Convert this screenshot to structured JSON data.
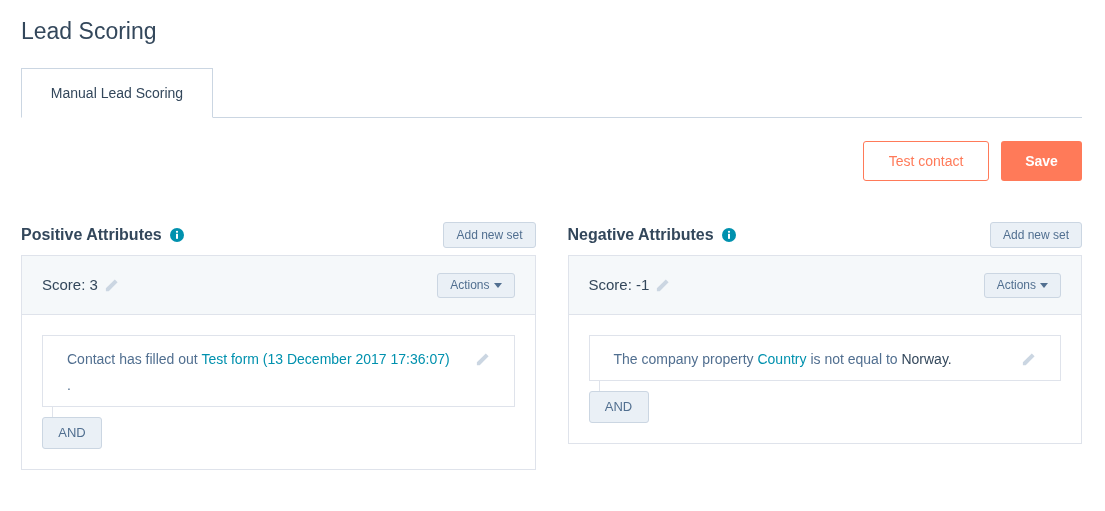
{
  "page_title": "Lead Scoring",
  "tabs": [
    {
      "label": "Manual Lead Scoring",
      "selected": true
    }
  ],
  "toolbar": {
    "test_button": "Test contact",
    "save_button": "Save"
  },
  "panels": [
    {
      "title": "Positive Attributes",
      "add_button": "Add new set",
      "sets": [
        {
          "score": "Score: 3",
          "actions_button": "Actions",
          "rules": [
            {
              "segments": [
                {
                  "kind": "text",
                  "text": "Contact has filled out "
                },
                {
                  "kind": "link",
                  "text": "Test form (13 December 2017 17:36:07)"
                }
              ],
              "trailing": "."
            }
          ],
          "and_button": "AND"
        }
      ]
    },
    {
      "title": "Negative Attributes",
      "add_button": "Add new set",
      "sets": [
        {
          "score": "Score: -1",
          "actions_button": "Actions",
          "rules": [
            {
              "segments": [
                {
                  "kind": "text",
                  "text": "The company property "
                },
                {
                  "kind": "link",
                  "text": "Country"
                },
                {
                  "kind": "text",
                  "text": " is not equal to "
                },
                {
                  "kind": "value",
                  "text": "Norway."
                }
              ]
            }
          ],
          "and_button": "AND"
        }
      ]
    }
  ]
}
